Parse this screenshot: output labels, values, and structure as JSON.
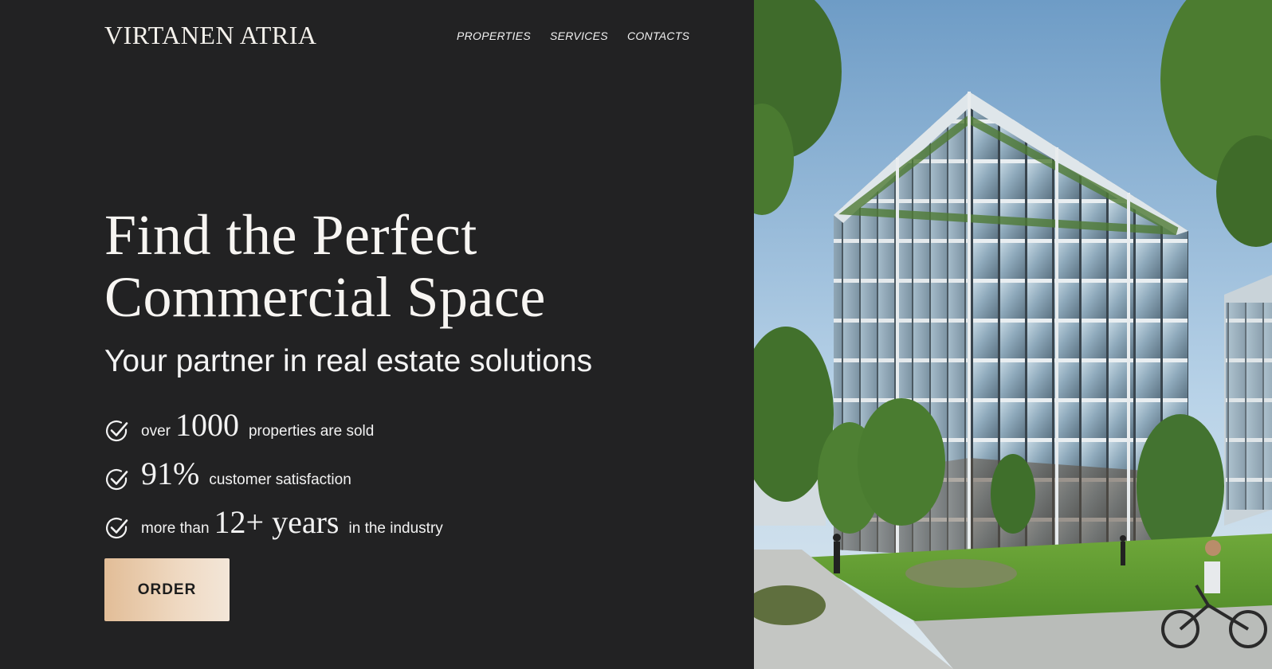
{
  "brand": {
    "name": "VIRTANEN ATRIA"
  },
  "nav": {
    "items": [
      "PROPERTIES",
      "SERVICES",
      "CONTACTS"
    ]
  },
  "hero": {
    "title_line1": "Find the Perfect",
    "title_line2": "Commercial Space",
    "subtitle": "Your partner in real estate solutions",
    "stats": [
      {
        "prefix": "over",
        "value": "1000",
        "suffix": "properties are sold"
      },
      {
        "prefix": "",
        "value": "91%",
        "suffix": "customer satisfaction"
      },
      {
        "prefix": "more than",
        "value": "12+ years",
        "suffix": "in the industry"
      }
    ],
    "cta_label": "ORDER"
  },
  "colors": {
    "background": "#222223",
    "accent_gradient_start": "#e2bd97",
    "accent_gradient_end": "#f3e6d8",
    "text": "#f4f1ec"
  },
  "icons": {
    "stat_icon": "check-circle-icon"
  },
  "image": {
    "subject": "glass-office-building-photo"
  }
}
